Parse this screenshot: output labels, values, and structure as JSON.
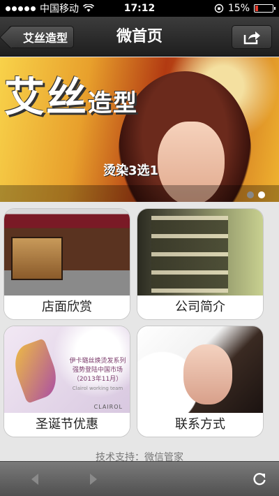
{
  "status_bar": {
    "carrier": "中国移动",
    "time": "17:12",
    "battery": "15%",
    "battery_level": 0.15,
    "battery_color": "#e53a2a"
  },
  "nav": {
    "back_label": "艾丝造型",
    "title": "微首页",
    "share_icon": "share-icon"
  },
  "banner": {
    "title_big": "艾丝",
    "title_small": "造型",
    "subtitle": "烫染3选1",
    "slide_count": 2,
    "active_slide": 2
  },
  "tiles": [
    {
      "label": "店面欣赏"
    },
    {
      "label": "公司简介"
    },
    {
      "label": "圣诞节优惠",
      "image_text": {
        "line1": "伊卡璐丝焕烫发系列",
        "line2": "强势登陆中国市场",
        "line3": "（2013年11月）",
        "line4": "Clairol working team",
        "brand": "CLAIROL"
      }
    },
    {
      "label": "联系方式"
    }
  ],
  "footer": {
    "support": "技术支持：微信管家"
  },
  "toolbar": {
    "back_icon": "back-arrow-icon",
    "forward_icon": "forward-arrow-icon",
    "refresh_icon": "refresh-icon"
  }
}
